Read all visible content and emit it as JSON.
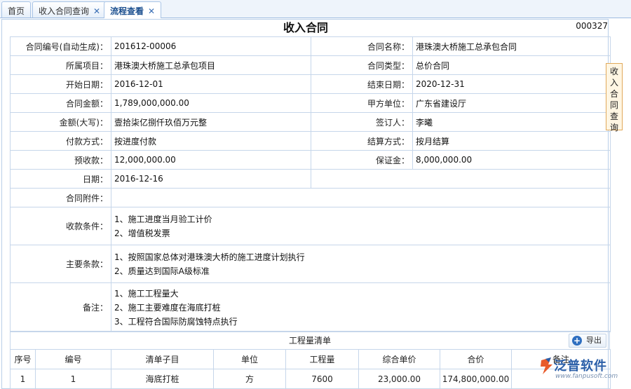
{
  "tabs": [
    {
      "label": "首页",
      "closable": false,
      "active": false
    },
    {
      "label": "收入合同查询",
      "closable": true,
      "active": false
    },
    {
      "label": "流程查看",
      "closable": true,
      "active": true
    }
  ],
  "page": {
    "title": "收入合同",
    "serial": "000327"
  },
  "form": {
    "contract_no_label": "合同编号(自动生成)：",
    "contract_no": "201612-00006",
    "contract_name_label": "合同名称：",
    "contract_name": "港珠澳大桥施工总承包合同",
    "project_label": "所属项目：",
    "project": "港珠澳大桥施工总承包项目",
    "contract_type_label": "合同类型：",
    "contract_type": "总价合同",
    "start_label": "开始日期：",
    "start": "2016-12-01",
    "end_label": "结束日期：",
    "end": "2020-12-31",
    "amount_label": "合同金额：",
    "amount": "1,789,000,000.00",
    "party_a_label": "甲方单位：",
    "party_a": "广东省建设厅",
    "amount_cn_label": "金额(大写)：",
    "amount_cn": "壹拾柒亿捌仟玖佰万元整",
    "signer_label": "签订人：",
    "signer": "李曦",
    "payment_label": "付款方式：",
    "payment": "按进度付款",
    "settlement_label": "结算方式：",
    "settlement": "按月结算",
    "prepay_label": "预收款：",
    "prepay": "12,000,000.00",
    "deposit_label": "保证金：",
    "deposit": "8,000,000.00",
    "date_label": "日期：",
    "date": "2016-12-16",
    "attachment_label": "合同附件：",
    "collection_label": "收款条件：",
    "collection": [
      "1、施工进度当月验工计价",
      "2、增值税发票"
    ],
    "terms_label": "主要条款：",
    "terms": [
      "1、按照国家总体对港珠澳大桥的施工进度计划执行",
      "2、质量达到国际A级标准"
    ],
    "remarks_label": "备注：",
    "remarks": [
      "1、施工工程量大",
      "2、施工主要难度在海底打桩",
      "3、工程符合国际防腐蚀特点执行"
    ]
  },
  "side_tab": {
    "label": [
      "收",
      "入",
      "合",
      "同",
      "查",
      "询"
    ]
  },
  "quantity_list": {
    "title": "工程量清单",
    "export_label": "导出",
    "columns": [
      "序号",
      "编号",
      "清单子目",
      "单位",
      "工程量",
      "综合单价",
      "合价",
      "备注"
    ],
    "rows": [
      [
        "1",
        "1",
        "海底打桩",
        "方",
        "7600",
        "23,000.00",
        "174,800,000.00",
        ""
      ]
    ]
  },
  "logo": {
    "brand": "泛普软件",
    "url": "www.fanpusoft.com"
  },
  "colors": {
    "accent": "#2f6fc0",
    "signer_text": "#1a3cb5",
    "side_tab_bg": "#fff6e3"
  }
}
